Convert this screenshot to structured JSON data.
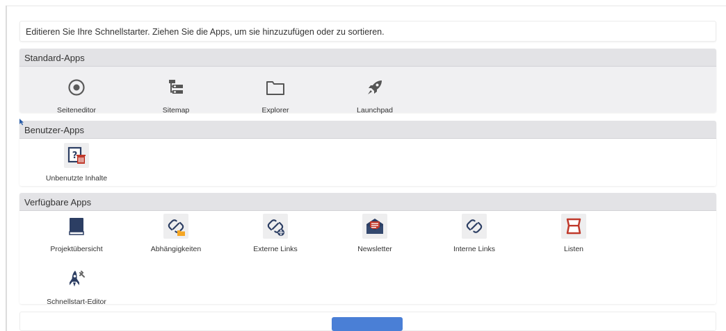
{
  "intro_text": "Editieren Sie Ihre Schnellstarter. Ziehen Sie die Apps, um sie hinzuzufügen oder zu sortieren.",
  "sections": {
    "standard": {
      "title": "Standard-Apps",
      "apps": [
        {
          "label": "Seiteneditor",
          "icon": "target-icon"
        },
        {
          "label": "Sitemap",
          "icon": "sitemap-icon"
        },
        {
          "label": "Explorer",
          "icon": "folder-icon"
        },
        {
          "label": "Launchpad",
          "icon": "rocket-icon"
        }
      ]
    },
    "user": {
      "title": "Benutzer-Apps",
      "apps": [
        {
          "label": "Unbenutzte Inhalte",
          "icon": "unused-content-icon"
        }
      ]
    },
    "available": {
      "title": "Verfügbare Apps",
      "apps": [
        {
          "label": "Projektübersicht",
          "icon": "book-icon"
        },
        {
          "label": "Abhängigkeiten",
          "icon": "link-folder-icon"
        },
        {
          "label": "Externe Links",
          "icon": "link-globe-icon"
        },
        {
          "label": "Newsletter",
          "icon": "newsletter-icon"
        },
        {
          "label": "Interne Links",
          "icon": "link-icon"
        },
        {
          "label": "Listen",
          "icon": "list-icon"
        },
        {
          "label": "Schnellstart-Editor",
          "icon": "rocket-tools-icon"
        }
      ]
    }
  },
  "colors": {
    "icon_navy": "#2c3e63",
    "icon_gray": "#4d4d4d",
    "accent_red": "#c0392b",
    "accent_orange": "#f5a623",
    "primary_button": "#4a7fd6"
  }
}
